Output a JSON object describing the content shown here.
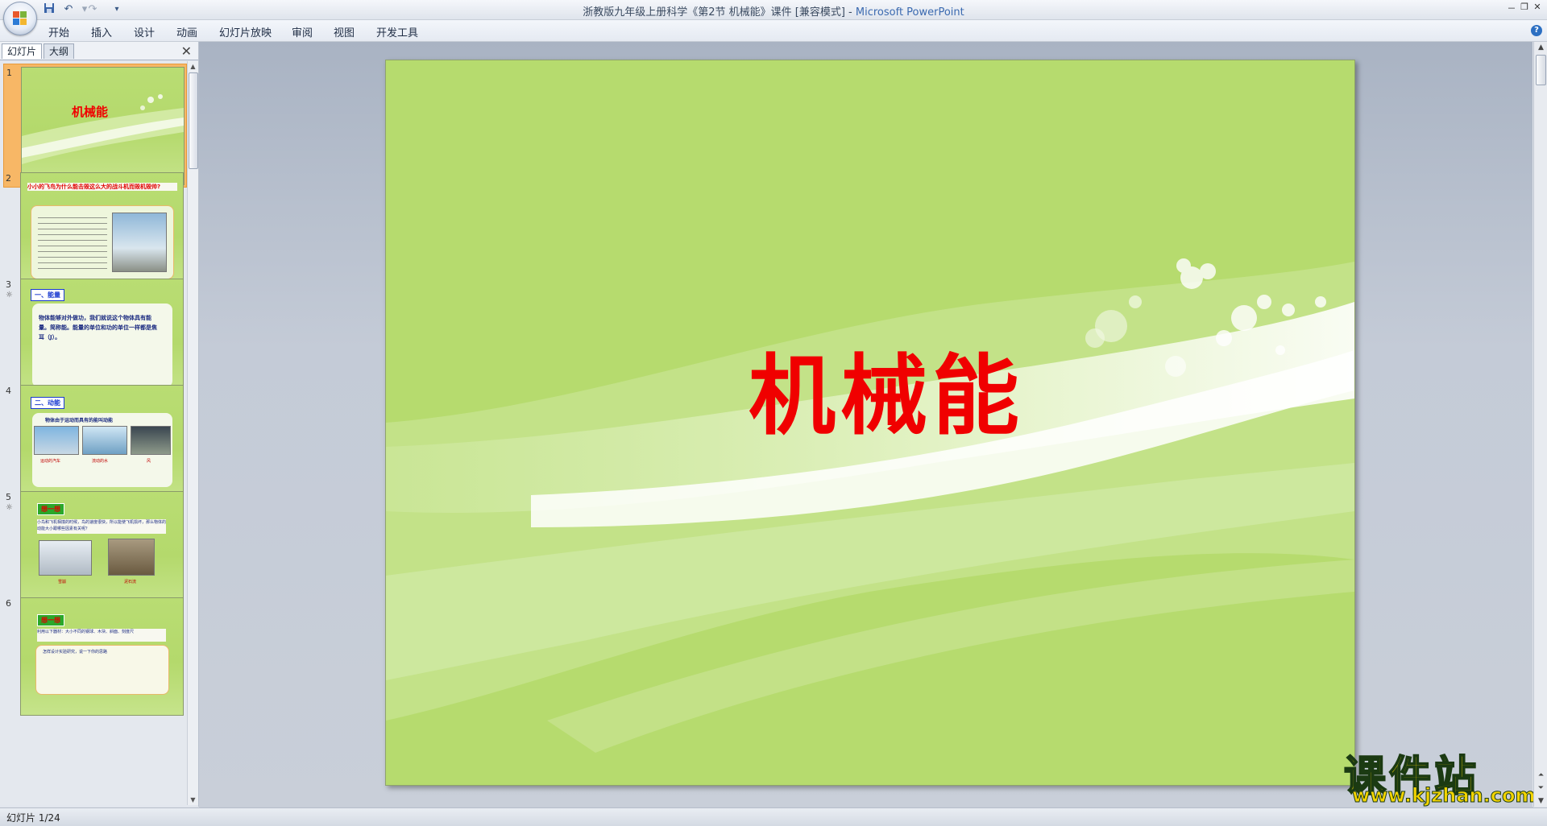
{
  "window": {
    "title_doc": "浙教版九年级上册科学《第2节 机械能》课件 [兼容模式] - ",
    "title_app": "Microsoft PowerPoint",
    "controls": [
      "－",
      "❐",
      "✕"
    ]
  },
  "quick_access": [
    "save-icon",
    "undo-icon",
    "redo-icon",
    "customize-icon"
  ],
  "ribbon": {
    "tabs": [
      "开始",
      "插入",
      "设计",
      "动画",
      "幻灯片放映",
      "审阅",
      "视图",
      "开发工具"
    ]
  },
  "left_pane": {
    "tabs": [
      "幻灯片",
      "大纲"
    ],
    "close": "✕",
    "slides": [
      {
        "number": "1",
        "note": "",
        "title": "机械能"
      },
      {
        "number": "2",
        "note": "",
        "title": "小小的飞鸟为什么能击毁这么大的战斗机而毁机毁帅?"
      },
      {
        "number": "3",
        "note": "☼",
        "tag": "一、能量",
        "body": "物体能够对外做功，我们就说这个物体具有能量。简称能。能量的单位和功的单位一样都是焦耳（J）。"
      },
      {
        "number": "4",
        "note": "",
        "tag": "二、动能",
        "body": "物体由于运动而具有的能叫动能",
        "captions": [
          "运动的汽车",
          "流动的水",
          "风"
        ]
      },
      {
        "number": "5",
        "note": "☼",
        "tag": "想一想",
        "body": "小鸟和飞机相撞的时候，鸟的速度很快，所以能使飞机损坏，那么物体的动能大小跟哪些因素有关呢？",
        "captions": [
          "雪崩",
          "泥石流"
        ]
      },
      {
        "number": "6",
        "note": "",
        "tag": "想一想",
        "body": "利用以下器材：大小不同的钢球、木块、斜面、刻度尺",
        "body2": "怎样设计实验研究，说一下你的思路"
      }
    ]
  },
  "slide": {
    "title": "机械能",
    "title_color": "#f00000",
    "background": "#b6db6e"
  },
  "watermark": {
    "cn": "课件站",
    "url": "www.kjzhan.com"
  },
  "status": {
    "text": "幻灯片 1/24"
  }
}
